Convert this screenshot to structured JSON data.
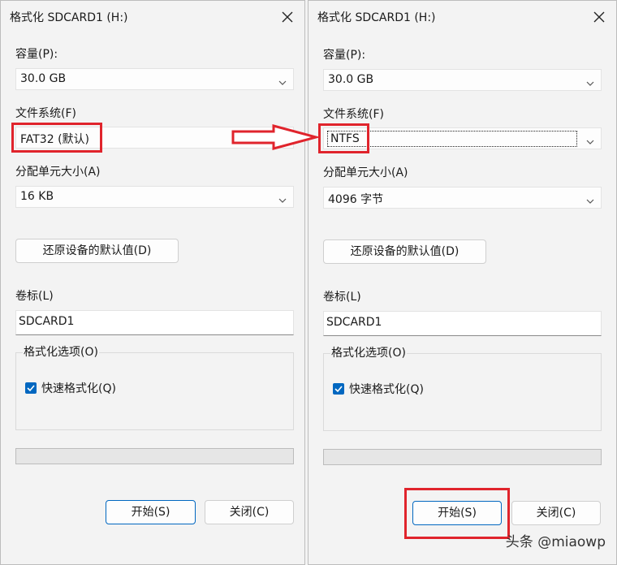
{
  "left_dialog": {
    "title": "格式化 SDCARD1 (H:)",
    "capacity_label": "容量(P):",
    "capacity_value": "30.0 GB",
    "filesystem_label": "文件系统(F)",
    "filesystem_value": "FAT32 (默认)",
    "allocation_label": "分配单元大小(A)",
    "allocation_value": "16 KB",
    "restore_button": "还原设备的默认值(D)",
    "volume_label": "卷标(L)",
    "volume_value": "SDCARD1",
    "options_title": "格式化选项(O)",
    "quick_format_label": "快速格式化(Q)",
    "quick_format_checked": true,
    "progress": 0,
    "start_button": "开始(S)",
    "close_button": "关闭(C)"
  },
  "right_dialog": {
    "title": "格式化 SDCARD1 (H:)",
    "capacity_label": "容量(P):",
    "capacity_value": "30.0 GB",
    "filesystem_label": "文件系统(F)",
    "filesystem_value": "NTFS",
    "allocation_label": "分配单元大小(A)",
    "allocation_value": "4096 字节",
    "restore_button": "还原设备的默认值(D)",
    "volume_label": "卷标(L)",
    "volume_value": "SDCARD1",
    "options_title": "格式化选项(O)",
    "quick_format_label": "快速格式化(Q)",
    "quick_format_checked": true,
    "progress": 0,
    "start_button": "开始(S)",
    "close_button": "关闭(C)"
  },
  "watermark": "头条 @miaowp",
  "colors": {
    "highlight": "#e0242c",
    "accent": "#0067c0",
    "dialog_bg": "#f3f3f3"
  },
  "icons": {
    "close": "close-icon",
    "dropdown": "chevron-down-icon",
    "check": "checkmark-icon",
    "arrow": "right-arrow-icon"
  }
}
